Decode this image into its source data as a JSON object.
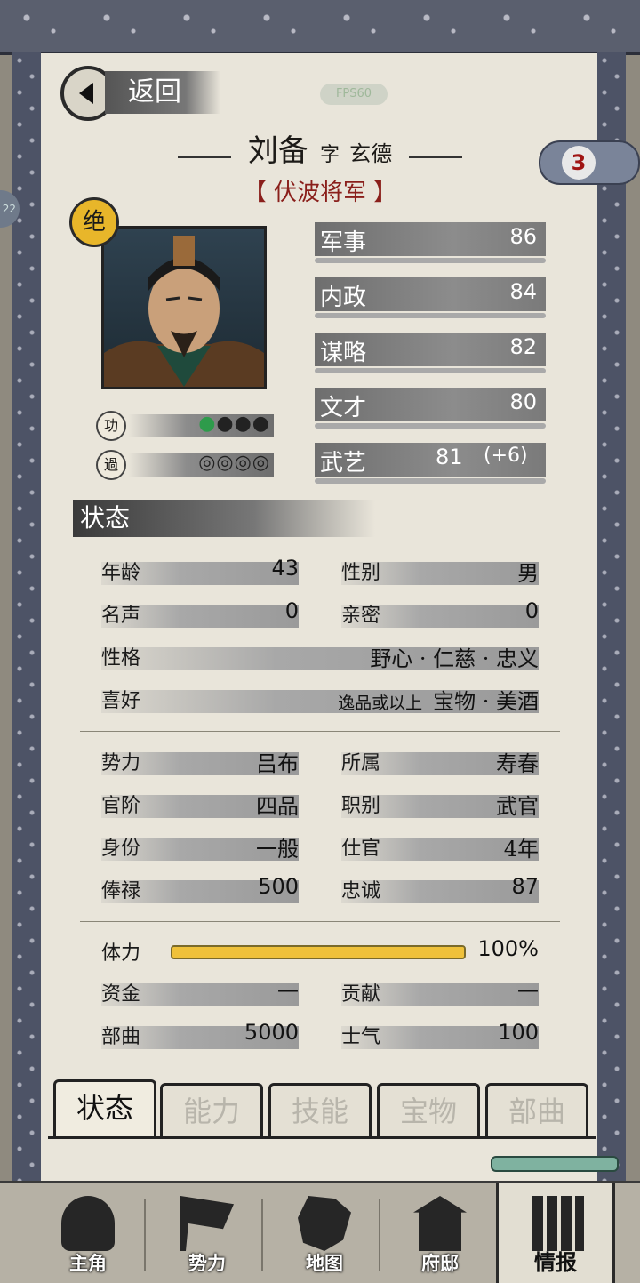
{
  "header": {
    "back_label": "返回",
    "fps_text": "FPS60",
    "name": "刘备",
    "zi_label": "字",
    "zi_name": "玄德",
    "title": "【 伏波将军 】",
    "badge_count": "3",
    "side_badge": "22"
  },
  "portrait": {
    "rank_mark": "绝",
    "merit_label": "功",
    "demerit_label": "過",
    "merit_marks": [
      "●",
      "●",
      "●",
      "●"
    ],
    "merit_filled": 1,
    "demerit_marks": [
      "◎",
      "◎",
      "◎",
      "◎"
    ],
    "demerit_filled": 0
  },
  "attributes": [
    {
      "label": "军事",
      "value": "86"
    },
    {
      "label": "内政",
      "value": "84"
    },
    {
      "label": "谋略",
      "value": "82"
    },
    {
      "label": "文才",
      "value": "80"
    },
    {
      "label": "武艺",
      "value": "81",
      "bonus": "(+6)"
    }
  ],
  "status": {
    "heading": "状态",
    "age": {
      "label": "年龄",
      "value": "43"
    },
    "gender": {
      "label": "性别",
      "value": "男"
    },
    "fame": {
      "label": "名声",
      "value": "0"
    },
    "intimacy": {
      "label": "亲密",
      "value": "0"
    },
    "personality": {
      "label": "性格",
      "value": "野心 · 仁慈 · 忠义"
    },
    "hobby": {
      "label": "喜好",
      "qualifier": "逸品或以上",
      "value": "宝物 · 美酒"
    },
    "faction": {
      "label": "势力",
      "value": "吕布"
    },
    "location": {
      "label": "所属",
      "value": "寿春"
    },
    "rank": {
      "label": "官阶",
      "value": "四品"
    },
    "post": {
      "label": "职别",
      "value": "武官"
    },
    "identity": {
      "label": "身份",
      "value": "一般"
    },
    "service": {
      "label": "仕官",
      "value": "4年"
    },
    "salary": {
      "label": "俸禄",
      "value": "500"
    },
    "loyalty": {
      "label": "忠诚",
      "value": "87"
    },
    "stamina": {
      "label": "体力",
      "value": "100%",
      "fraction": 1.0
    },
    "funds": {
      "label": "资金",
      "value": "—"
    },
    "contribution": {
      "label": "贡献",
      "value": "—"
    },
    "troops": {
      "label": "部曲",
      "value": "5000"
    },
    "morale": {
      "label": "士气",
      "value": "100"
    }
  },
  "tabs": [
    {
      "label": "状态",
      "active": true
    },
    {
      "label": "能力",
      "active": false
    },
    {
      "label": "技能",
      "active": false
    },
    {
      "label": "宝物",
      "active": false
    },
    {
      "label": "部曲",
      "active": false
    }
  ],
  "nav": [
    {
      "label": "主角",
      "icon": "hero-icon"
    },
    {
      "label": "势力",
      "icon": "flag-icon"
    },
    {
      "label": "地图",
      "icon": "map-icon"
    },
    {
      "label": "府邸",
      "icon": "mansion-icon"
    },
    {
      "label": "情报",
      "icon": "scroll-icon",
      "active": true
    }
  ]
}
